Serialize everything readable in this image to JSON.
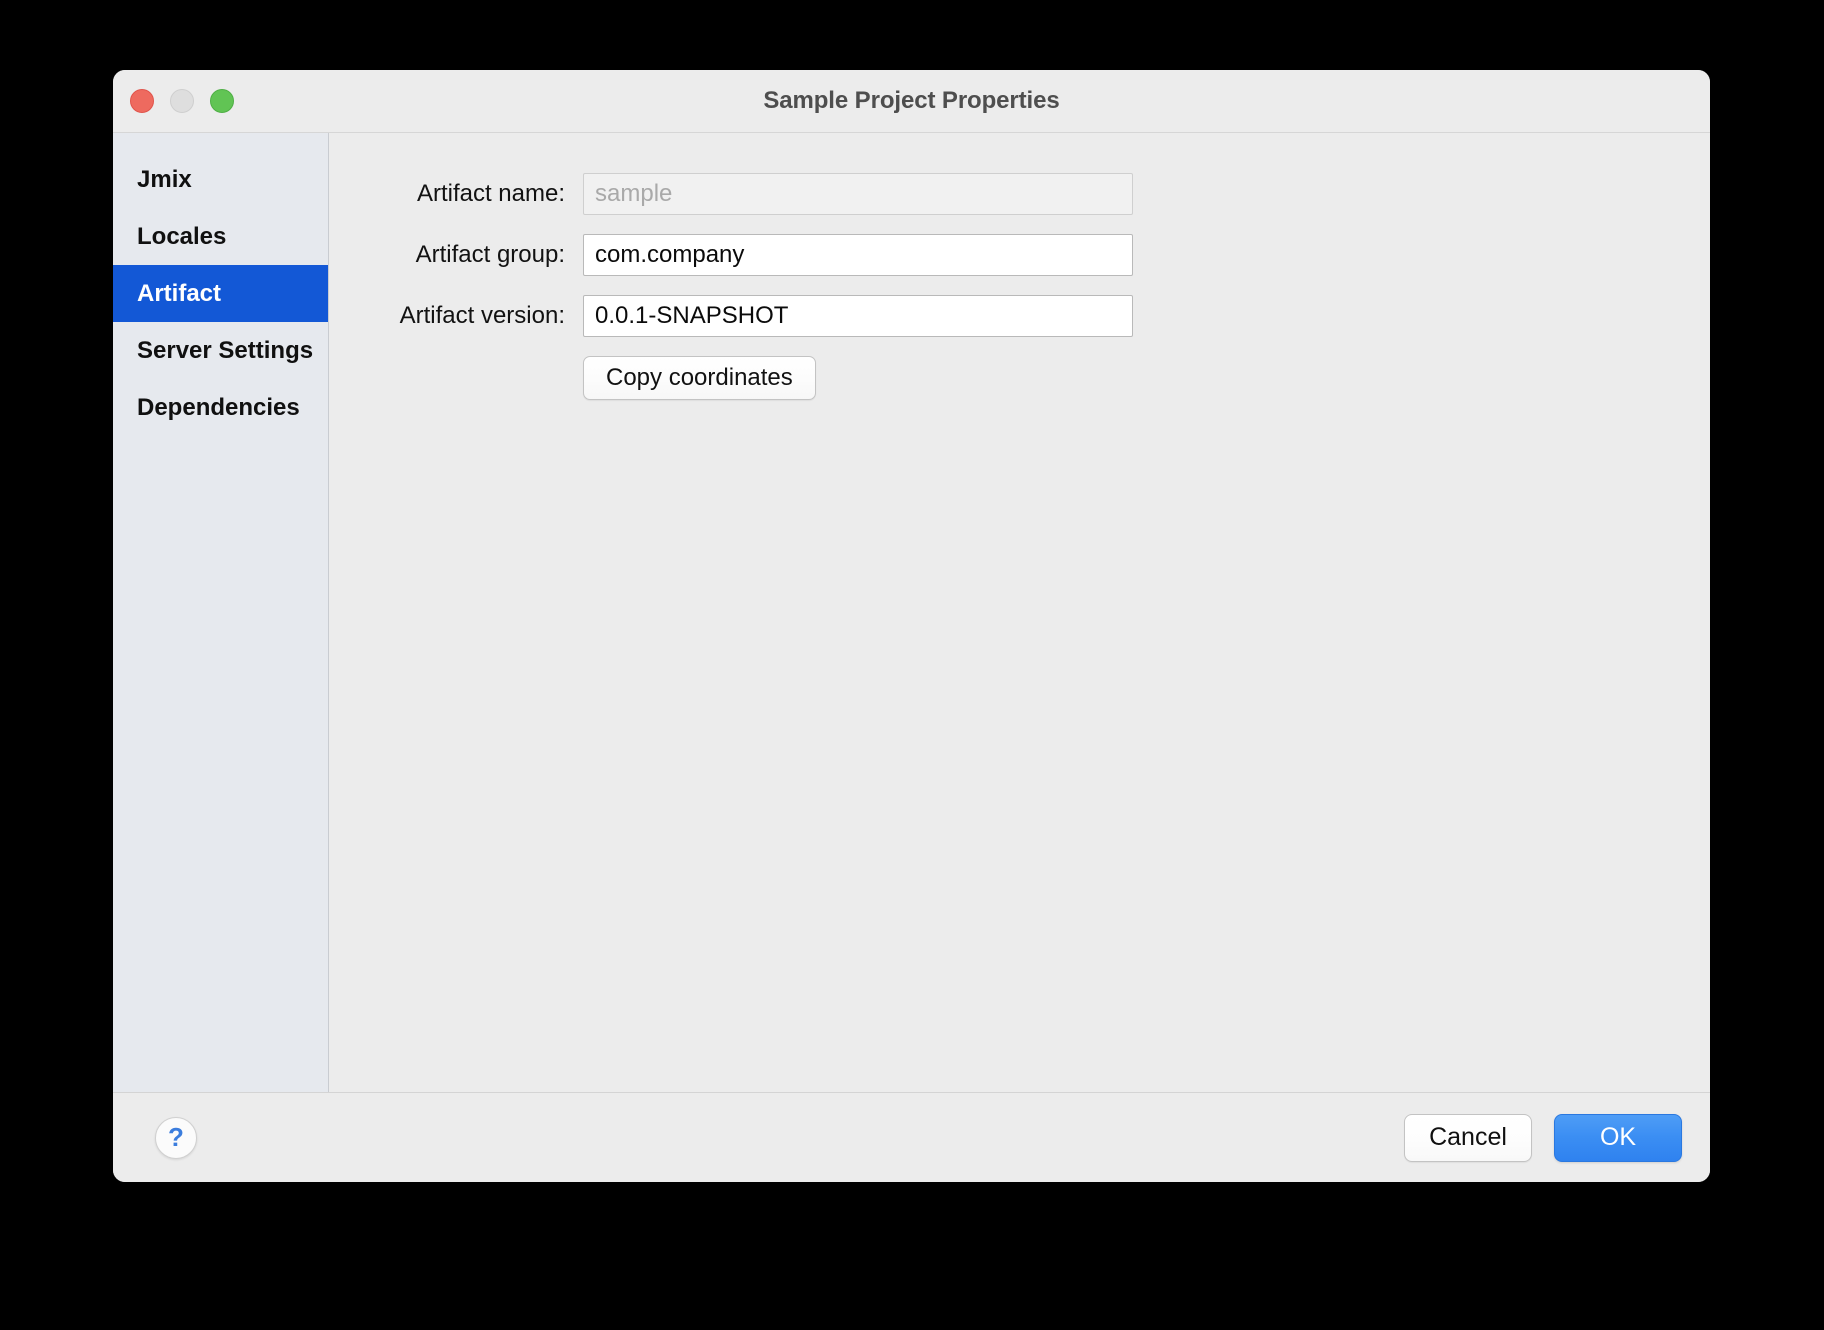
{
  "window": {
    "title": "Sample Project Properties",
    "traffic_lights": [
      {
        "name": "close",
        "color": "#ee6a5f"
      },
      {
        "name": "minimize",
        "color": "#dedede"
      },
      {
        "name": "maximize",
        "color": "#61c454"
      }
    ]
  },
  "sidebar": {
    "items": [
      {
        "label": "Jmix",
        "selected": false
      },
      {
        "label": "Locales",
        "selected": false
      },
      {
        "label": "Artifact",
        "selected": true
      },
      {
        "label": "Server Settings",
        "selected": false
      },
      {
        "label": "Dependencies",
        "selected": false
      }
    ],
    "selected_color": "#1358d6",
    "background": "#e6e9ee"
  },
  "form": {
    "fields": [
      {
        "label": "Artifact name:",
        "value": "",
        "placeholder": "sample",
        "readonly": true
      },
      {
        "label": "Artifact group:",
        "value": "com.company",
        "placeholder": "",
        "readonly": false
      },
      {
        "label": "Artifact version:",
        "value": "0.0.1-SNAPSHOT",
        "placeholder": "",
        "readonly": false
      }
    ],
    "copy_coordinates_label": "Copy coordinates"
  },
  "footer": {
    "help_glyph": "?",
    "cancel_label": "Cancel",
    "ok_label": "OK",
    "ok_color": "#3b8ef3"
  }
}
